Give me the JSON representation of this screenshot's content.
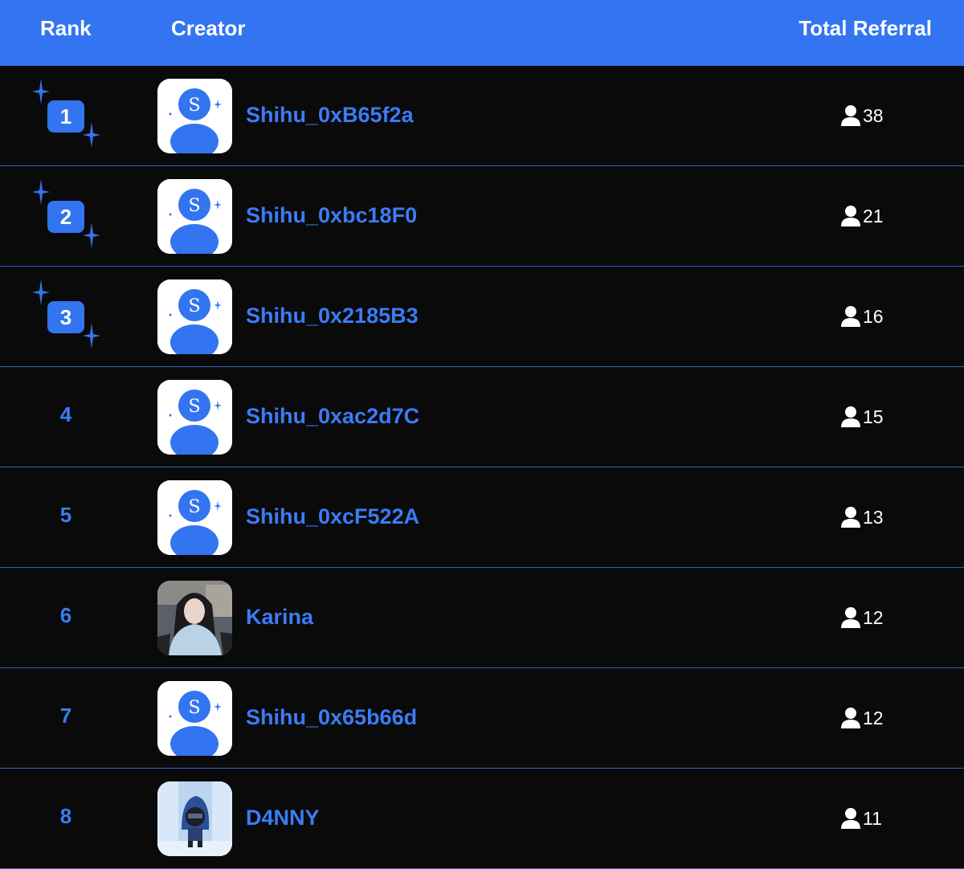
{
  "header": {
    "rank": "Rank",
    "creator": "Creator",
    "total": "Total Referral"
  },
  "colors": {
    "accent": "#3374f0",
    "background": "#0a0a0b",
    "divider": "#2f5fc4",
    "text_on_accent": "#ffffff"
  },
  "rows": [
    {
      "rank": "1",
      "name": "Shihu_0xB65f2a",
      "referrals": "38",
      "top": true,
      "avatar": "default-s-avatar"
    },
    {
      "rank": "2",
      "name": "Shihu_0xbc18F0",
      "referrals": "21",
      "top": true,
      "avatar": "default-s-avatar"
    },
    {
      "rank": "3",
      "name": "Shihu_0x2185B3",
      "referrals": "16",
      "top": true,
      "avatar": "default-s-avatar"
    },
    {
      "rank": "4",
      "name": "Shihu_0xac2d7C",
      "referrals": "15",
      "top": false,
      "avatar": "default-s-avatar"
    },
    {
      "rank": "5",
      "name": "Shihu_0xcF522A",
      "referrals": "13",
      "top": false,
      "avatar": "default-s-avatar"
    },
    {
      "rank": "6",
      "name": "Karina",
      "referrals": "12",
      "top": false,
      "avatar": "photo-avatar"
    },
    {
      "rank": "7",
      "name": "Shihu_0x65b66d",
      "referrals": "12",
      "top": false,
      "avatar": "default-s-avatar"
    },
    {
      "rank": "8",
      "name": "D4NNY",
      "referrals": "11",
      "top": false,
      "avatar": "game-character-avatar"
    }
  ]
}
